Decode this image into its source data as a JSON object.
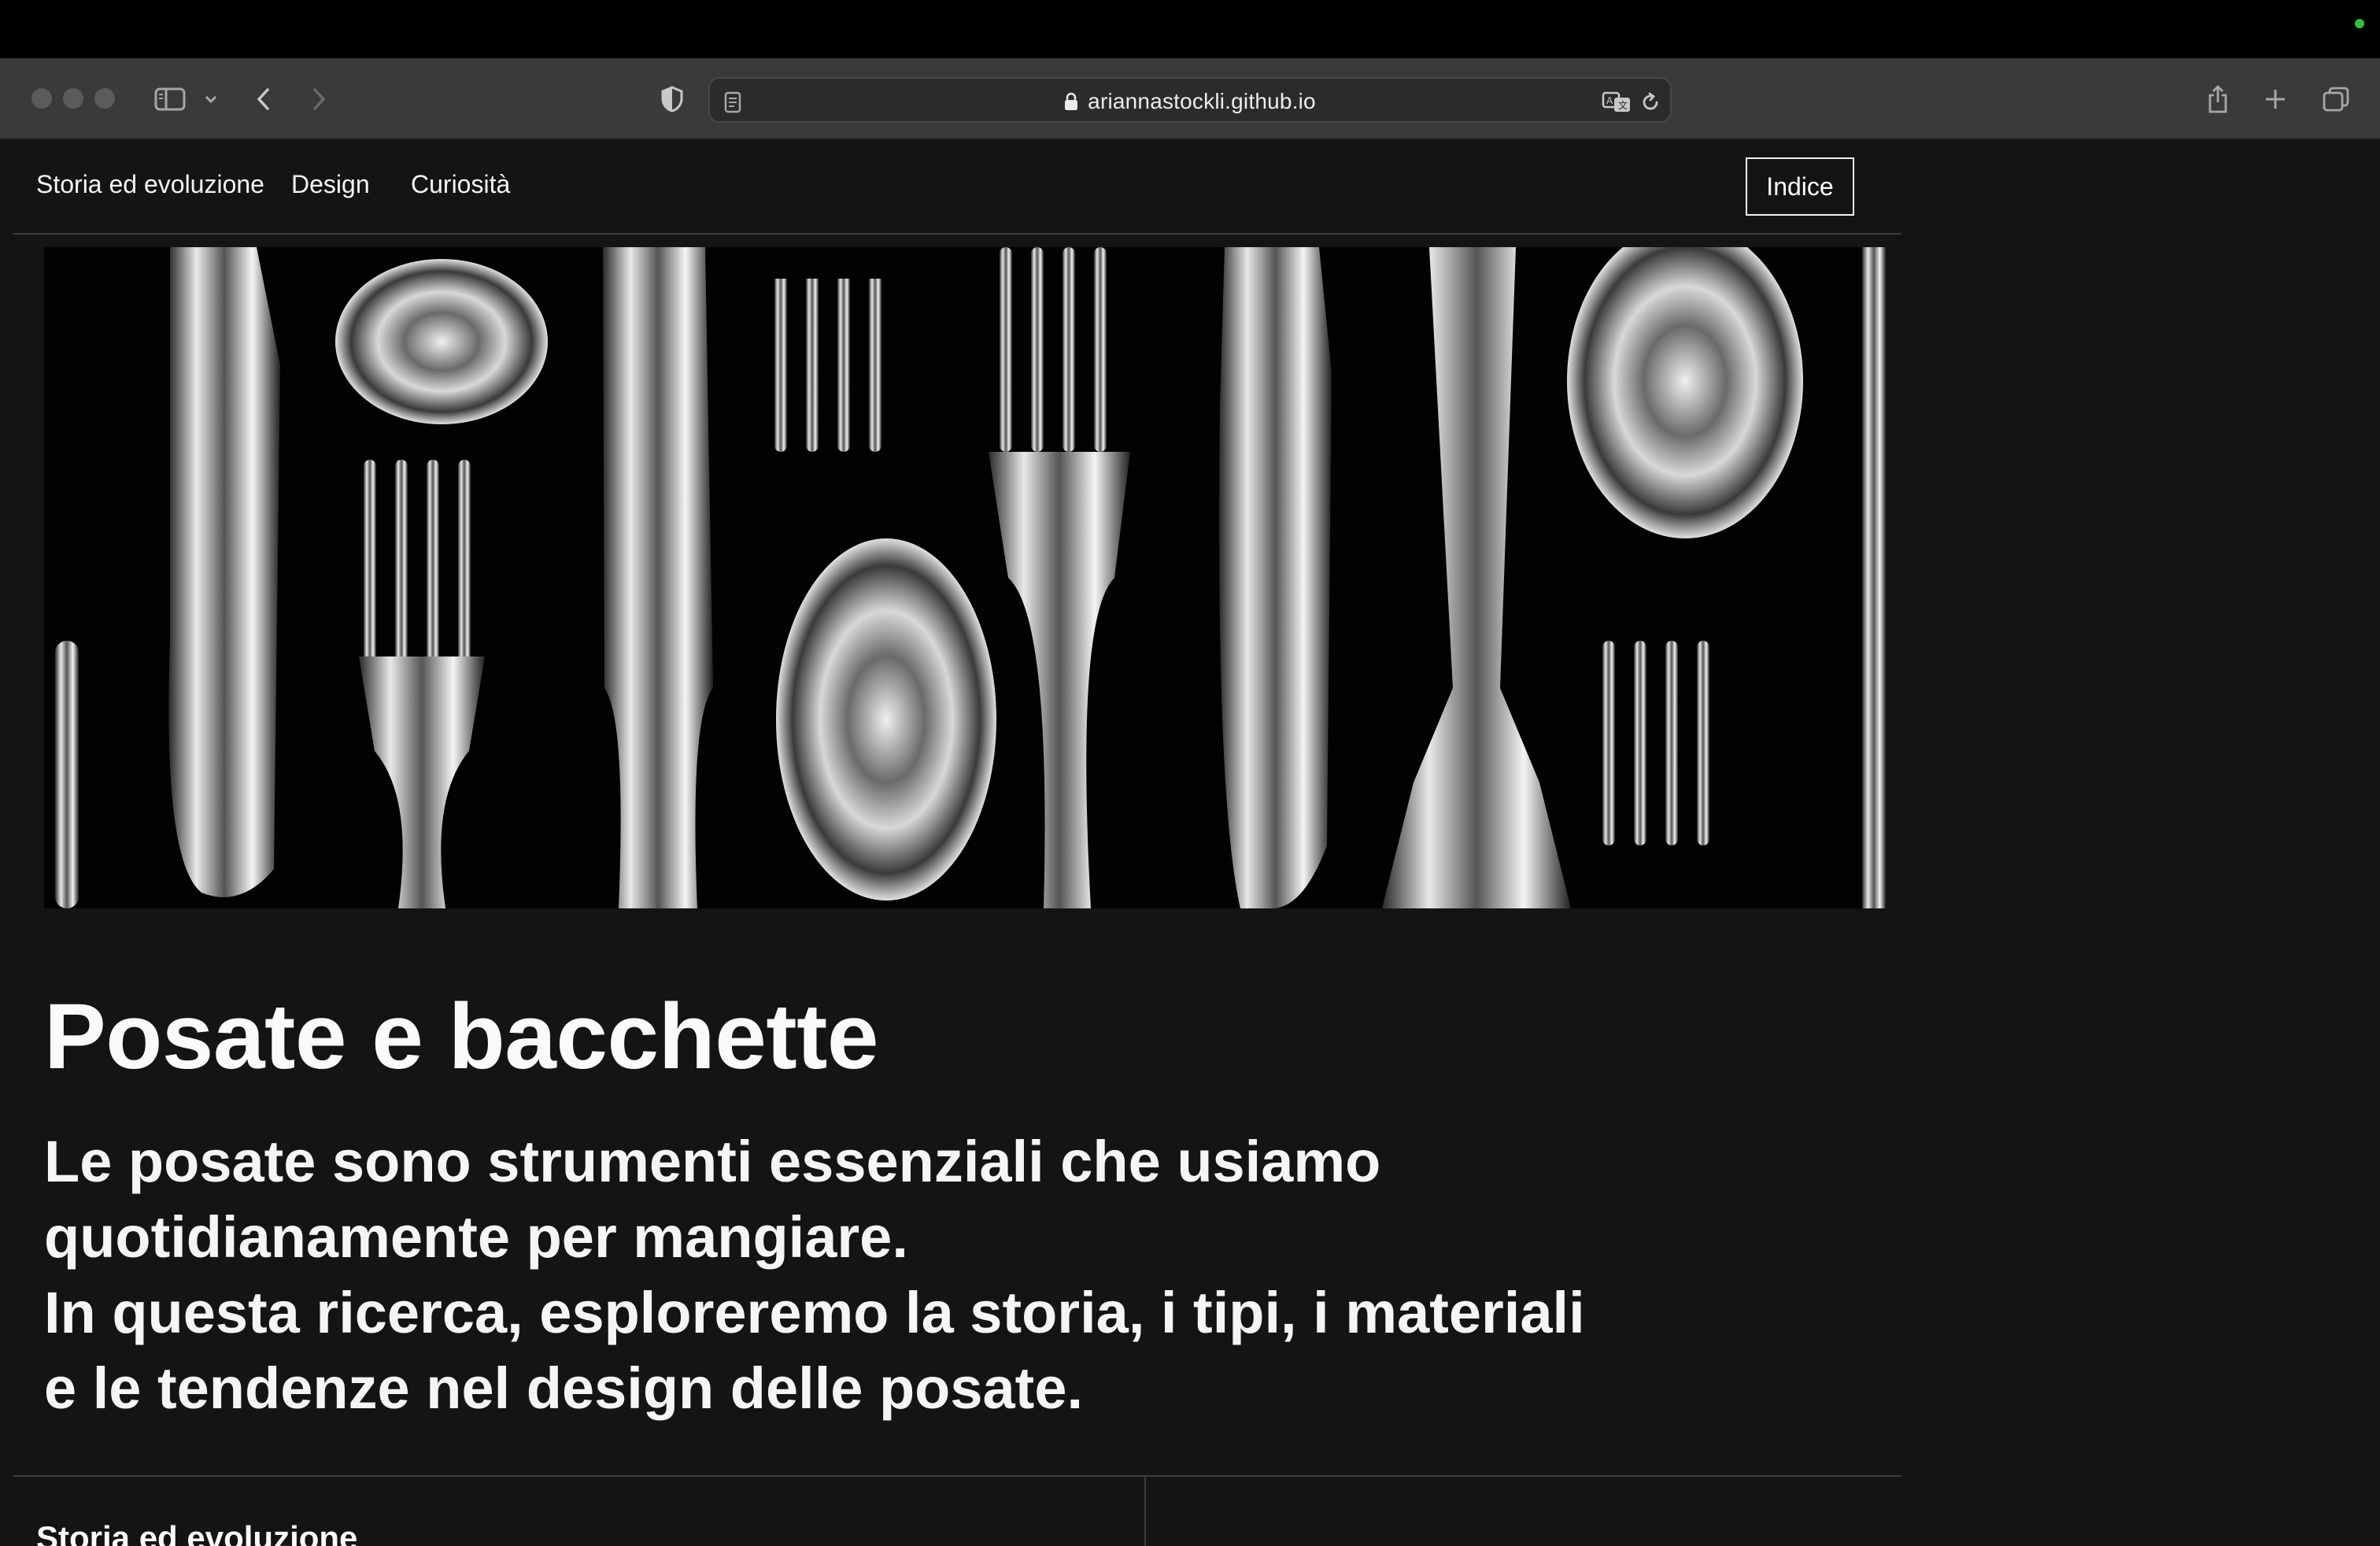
{
  "browser": {
    "url": "ariannastockli.github.io",
    "icons": [
      "sidebar-icon",
      "chevron-down-icon",
      "back-icon",
      "forward-icon",
      "privacy-shield-icon",
      "reader-icon",
      "lock-icon",
      "translate-icon",
      "reload-icon",
      "share-icon",
      "new-tab-icon",
      "tab-overview-icon"
    ]
  },
  "nav": {
    "links": [
      "Storia ed evoluzione",
      "Design",
      "Curiosità"
    ],
    "index_button": "Indice"
  },
  "hero": {
    "image_description_icon": "cutlery-photo"
  },
  "main": {
    "title": "Posate e bacchette",
    "intro_lines": [
      "Le posate sono strumenti essenziali che usiamo",
      "quotidianamente per mangiare.",
      "In questa ricerca, esploreremo la storia, i tipi, i materiali",
      "e le tendenze nel design delle posate."
    ]
  },
  "section": {
    "heading": "Storia ed evoluzione"
  },
  "colors": {
    "page_bg": "#141414",
    "toolbar_bg": "#3a3a3c",
    "status_green": "#32c13b"
  }
}
